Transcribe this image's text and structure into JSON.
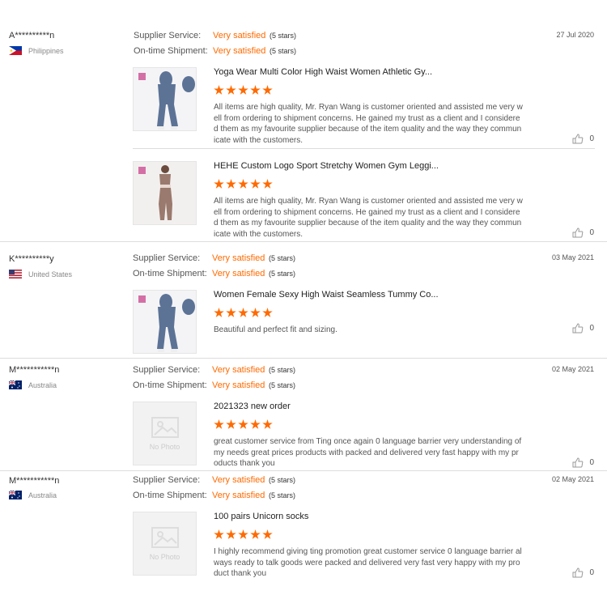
{
  "labels": {
    "supplier_service": "Supplier Service:",
    "ontime_shipment": "On-time Shipment:",
    "no_photo": "No Photo"
  },
  "colors": {
    "accent": "#ff6a00"
  },
  "reviews": [
    {
      "user": "A**********n",
      "country": "Philippines",
      "flag": "philippines-flag-icon",
      "date": "27 Jul 2020",
      "supplier_value": "Very satisfied",
      "supplier_stars": "(5 stars)",
      "shipment_value": "Very satisfied",
      "shipment_stars": "(5 stars)",
      "items": [
        {
          "title": "Yoga Wear Multi Color High Waist Women Athletic Gy...",
          "rating": 5,
          "text": "All items are high quality, Mr. Ryan Wang is customer oriented and assisted me very well from ordering to shipment concerns. He gained my trust as a client and I considered them as my favourite supplier because of the item quality and the way they communicate with the customers.",
          "likes": "0",
          "image": "blue-leggings-photo"
        },
        {
          "title": "HEHE Custom Logo Sport Stretchy Women Gym Leggi...",
          "rating": 5,
          "text": "All items are high quality, Mr. Ryan Wang is customer oriented and assisted me very well from ordering to shipment concerns. He gained my trust as a client and I considered them as my favourite supplier because of the item quality and the way they communicate with the customers.",
          "likes": "0",
          "image": "brown-leggings-photo"
        }
      ]
    },
    {
      "user": "K**********y",
      "country": "United States",
      "flag": "us-flag-icon",
      "date": "03 May 2021",
      "supplier_value": "Very satisfied",
      "supplier_stars": "(5 stars)",
      "shipment_value": "Very satisfied",
      "shipment_stars": "(5 stars)",
      "items": [
        {
          "title": "Women Female Sexy High Waist Seamless Tummy Co...",
          "rating": 5,
          "text": "Beautiful and perfect fit and sizing.",
          "likes": "0",
          "image": "blue-leggings-photo"
        }
      ]
    },
    {
      "user": "M***********n",
      "country": "Australia",
      "flag": "australia-flag-icon",
      "date": "02 May 2021",
      "supplier_value": "Very satisfied",
      "supplier_stars": "(5 stars)",
      "shipment_value": "Very satisfied",
      "shipment_stars": "(5 stars)",
      "items": [
        {
          "title": "2021323 new order",
          "rating": 5,
          "text": "great customer service from Ting once again 0 language barrier very understanding of my needs great prices products with packed and delivered very fast happy with my products thank you",
          "likes": "0",
          "image": "no-photo"
        }
      ]
    },
    {
      "user": "M***********n",
      "country": "Australia",
      "flag": "australia-flag-icon",
      "date": "02 May 2021",
      "supplier_value": "Very satisfied",
      "supplier_stars": "(5 stars)",
      "shipment_value": "Very satisfied",
      "shipment_stars": "(5 stars)",
      "items": [
        {
          "title": "100 pairs Unicorn socks",
          "rating": 5,
          "text": "I highly recommend giving ting promotion great customer service 0 language barrier always ready to talk goods were packed and delivered very fast very happy with my product thank you",
          "likes": "0",
          "image": "no-photo"
        }
      ]
    }
  ]
}
